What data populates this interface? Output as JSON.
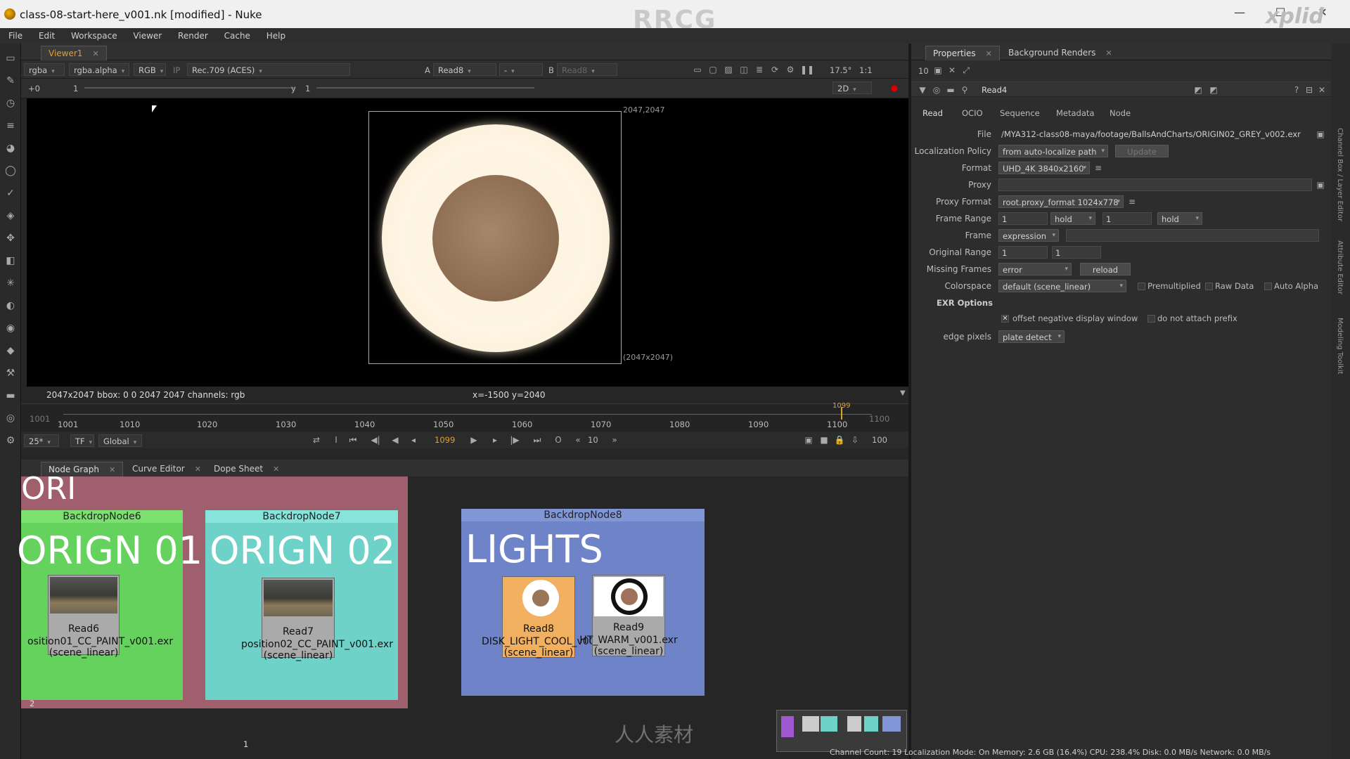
{
  "window": {
    "title": "class-08-start-here_v001.nk [modified] - Nuke",
    "watermark": "RRCG",
    "corner_logo": "xplid"
  },
  "menu": [
    "File",
    "Edit",
    "Workspace",
    "Viewer",
    "Render",
    "Cache",
    "Help"
  ],
  "viewer": {
    "tab": "Viewer1",
    "channels": "rgba",
    "alpha": "rgba.alpha",
    "display": "RGB",
    "ip": "IP",
    "colorspace": "Rec.709 (ACES)",
    "a_label": "A",
    "a_input": "Read8",
    "a_op": "-",
    "b_label": "B",
    "b_input": "Read8",
    "fstop": "17.5°",
    "ratio": "1:1",
    "gain": "+0",
    "gain_val": "1",
    "y_label": "y",
    "y_val": "1",
    "mode": "2D",
    "corner_tr": "2047,2047",
    "corner_br": "(2047x2047)",
    "info": "2047x2047  bbox: 0 0 2047 2047 channels: rgb",
    "coords": "x=-1500 y=2040"
  },
  "timeline": {
    "start": "1001",
    "end": "1100",
    "current": "1099",
    "marker": "1099",
    "ticks": [
      "1001",
      "1010",
      "1020",
      "1030",
      "1040",
      "1050",
      "1060",
      "1070",
      "1080",
      "1090",
      "1100"
    ],
    "fps": "25*",
    "tf": "TF",
    "global": "Global",
    "increment": "10",
    "end_frame": "100"
  },
  "nodegraph": {
    "tabs": [
      "Node Graph",
      "Curve Editor",
      "Dope Sheet"
    ],
    "cut_title": "ORI",
    "backdrops": [
      {
        "name": "BackdropNode6",
        "big": "ORIGN 01"
      },
      {
        "name": "BackdropNode7",
        "big": "ORIGN 02"
      },
      {
        "name": "BackdropNode8",
        "big": "LIGHTS"
      }
    ],
    "nodes": [
      {
        "name": "Read6",
        "file": "osition01_CC_PAINT_v001.exr",
        "cs": "(scene_linear)"
      },
      {
        "name": "Read7",
        "file": "position02_CC_PAINT_v001.exr",
        "cs": "(scene_linear)"
      },
      {
        "name": "Read8",
        "file": "DISK_LIGHT_COOL_v001.exr",
        "cs": "(scene_linear)"
      },
      {
        "name": "Read9",
        "file": "HT_WARM_v001.exr",
        "cs": "(scene_linear)"
      }
    ],
    "dot_label": "1",
    "edge_label": "2",
    "wm_text": "人人素材"
  },
  "properties": {
    "tabs": [
      "Properties",
      "Background Renders"
    ],
    "max_panels": "10",
    "node_name": "Read4",
    "subtabs": [
      "Read",
      "OCIO",
      "Sequence",
      "Metadata",
      "Node"
    ],
    "file": "/MYA312-class08-maya/footage/BallsAndCharts/ORIGIN02_GREY_v002.exr",
    "localization_policy": "from auto-localize path",
    "update": "Update",
    "format": "UHD_4K 3840x2160",
    "proxy": "",
    "proxy_format": "root.proxy_format 1024x778",
    "frame_range_start": "1",
    "frame_range_before": "hold",
    "frame_range_end": "1",
    "frame_range_after": "hold",
    "frame": "expression",
    "original_range_start": "1",
    "original_range_end": "1",
    "missing_frames": "error",
    "reload": "reload",
    "colorspace": "default (scene_linear)",
    "premultiplied": "Premultiplied",
    "raw_data": "Raw Data",
    "auto_alpha": "Auto Alpha",
    "exr_options": "EXR Options",
    "offset_label": "offset negative display window",
    "noprefix_label": "do not attach prefix",
    "edge_pixels": "plate detect",
    "labels": {
      "file": "File",
      "loc": "Localization Policy",
      "format": "Format",
      "proxy": "Proxy",
      "proxyfmt": "Proxy Format",
      "framerange": "Frame Range",
      "frame": "Frame",
      "orig": "Original Range",
      "missing": "Missing Frames",
      "cs": "Colorspace",
      "edge": "edge pixels"
    }
  },
  "sidebar_right": [
    "Channel Box / Layer Editor",
    "Attribute Editor",
    "Modeling Toolkit"
  ],
  "status": "Channel Count: 19  Localization Mode: On  Memory: 2.6 GB (16.4%)  CPU: 238.4%  Disk: 0.0 MB/s  Network: 0.0 MB/s"
}
